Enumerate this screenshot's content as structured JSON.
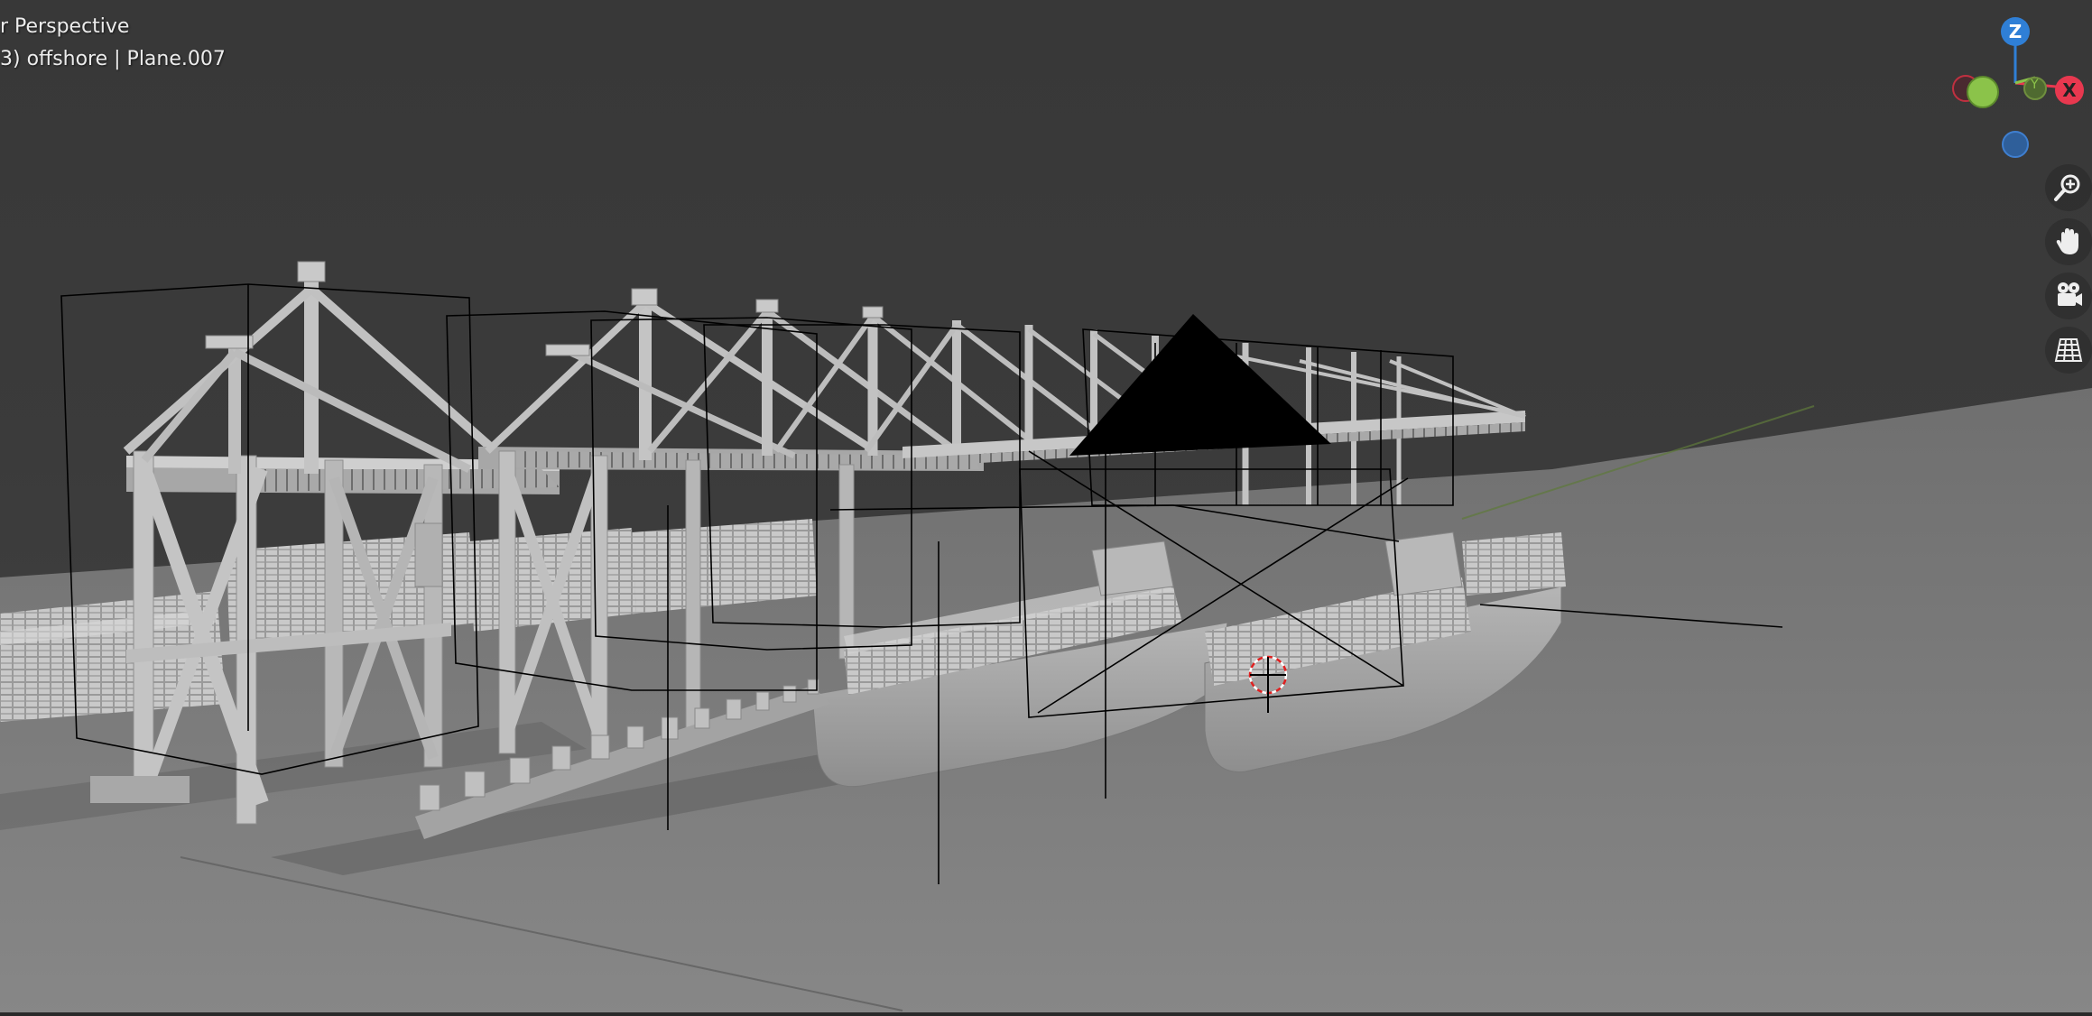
{
  "viewport": {
    "view_name": "r Perspective",
    "object_info": "3) offshore | Plane.007"
  },
  "gizmo": {
    "axis_z": "Z",
    "axis_y": "Y",
    "axis_x": "X",
    "colors": {
      "x": "#e8384f",
      "y": "#8bc34a",
      "z": "#2f7fd6"
    }
  },
  "navigation": {
    "zoom": "zoom-icon",
    "pan": "hand-icon",
    "camera": "camera-icon",
    "ortho": "grid-icon"
  },
  "colors": {
    "background": "#3b3b3b",
    "ground": "#7b7b7b",
    "model": "#b8b8b8"
  }
}
